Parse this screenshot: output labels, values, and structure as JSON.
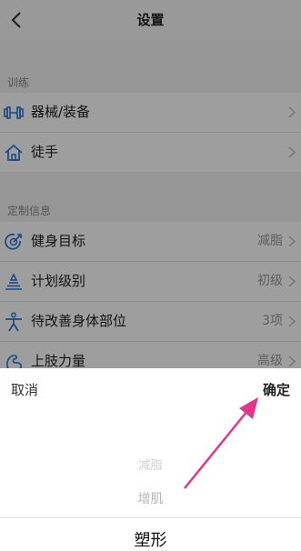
{
  "header": {
    "title": "设置"
  },
  "sections": [
    {
      "label": "训练",
      "items": [
        {
          "label": "器械/装备",
          "value": ""
        },
        {
          "label": "徒手",
          "value": ""
        }
      ]
    },
    {
      "label": "定制信息",
      "items": [
        {
          "label": "健身目标",
          "value": "减脂"
        },
        {
          "label": "计划级别",
          "value": "初级"
        },
        {
          "label": "待改善身体部位",
          "value": "3项"
        },
        {
          "label": "上肢力量",
          "value": "高级"
        }
      ]
    }
  ],
  "sheet": {
    "cancel_label": "取消",
    "confirm_label": "确定",
    "options": [
      "减脂",
      "增肌",
      "塑形"
    ]
  },
  "colors": {
    "accent": "#2a78d4",
    "annotation_arrow": "#e4358c"
  }
}
